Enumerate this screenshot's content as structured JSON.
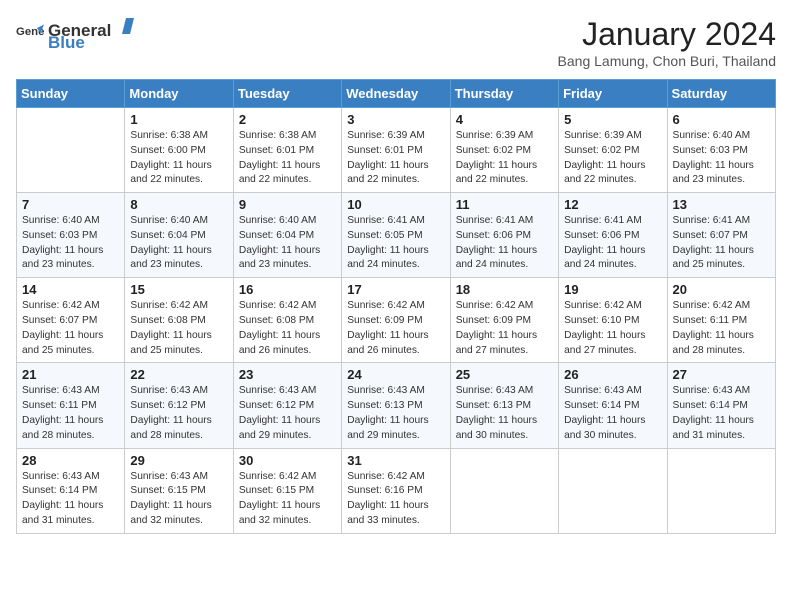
{
  "header": {
    "logo_general": "General",
    "logo_blue": "Blue",
    "month_year": "January 2024",
    "location": "Bang Lamung, Chon Buri, Thailand"
  },
  "days_of_week": [
    "Sunday",
    "Monday",
    "Tuesday",
    "Wednesday",
    "Thursday",
    "Friday",
    "Saturday"
  ],
  "weeks": [
    [
      {
        "day": "",
        "text": ""
      },
      {
        "day": "1",
        "text": "Sunrise: 6:38 AM\nSunset: 6:00 PM\nDaylight: 11 hours and 22 minutes."
      },
      {
        "day": "2",
        "text": "Sunrise: 6:38 AM\nSunset: 6:01 PM\nDaylight: 11 hours and 22 minutes."
      },
      {
        "day": "3",
        "text": "Sunrise: 6:39 AM\nSunset: 6:01 PM\nDaylight: 11 hours and 22 minutes."
      },
      {
        "day": "4",
        "text": "Sunrise: 6:39 AM\nSunset: 6:02 PM\nDaylight: 11 hours and 22 minutes."
      },
      {
        "day": "5",
        "text": "Sunrise: 6:39 AM\nSunset: 6:02 PM\nDaylight: 11 hours and 22 minutes."
      },
      {
        "day": "6",
        "text": "Sunrise: 6:40 AM\nSunset: 6:03 PM\nDaylight: 11 hours and 23 minutes."
      }
    ],
    [
      {
        "day": "7",
        "text": "Sunrise: 6:40 AM\nSunset: 6:03 PM\nDaylight: 11 hours and 23 minutes."
      },
      {
        "day": "8",
        "text": "Sunrise: 6:40 AM\nSunset: 6:04 PM\nDaylight: 11 hours and 23 minutes."
      },
      {
        "day": "9",
        "text": "Sunrise: 6:40 AM\nSunset: 6:04 PM\nDaylight: 11 hours and 23 minutes."
      },
      {
        "day": "10",
        "text": "Sunrise: 6:41 AM\nSunset: 6:05 PM\nDaylight: 11 hours and 24 minutes."
      },
      {
        "day": "11",
        "text": "Sunrise: 6:41 AM\nSunset: 6:06 PM\nDaylight: 11 hours and 24 minutes."
      },
      {
        "day": "12",
        "text": "Sunrise: 6:41 AM\nSunset: 6:06 PM\nDaylight: 11 hours and 24 minutes."
      },
      {
        "day": "13",
        "text": "Sunrise: 6:41 AM\nSunset: 6:07 PM\nDaylight: 11 hours and 25 minutes."
      }
    ],
    [
      {
        "day": "14",
        "text": "Sunrise: 6:42 AM\nSunset: 6:07 PM\nDaylight: 11 hours and 25 minutes."
      },
      {
        "day": "15",
        "text": "Sunrise: 6:42 AM\nSunset: 6:08 PM\nDaylight: 11 hours and 25 minutes."
      },
      {
        "day": "16",
        "text": "Sunrise: 6:42 AM\nSunset: 6:08 PM\nDaylight: 11 hours and 26 minutes."
      },
      {
        "day": "17",
        "text": "Sunrise: 6:42 AM\nSunset: 6:09 PM\nDaylight: 11 hours and 26 minutes."
      },
      {
        "day": "18",
        "text": "Sunrise: 6:42 AM\nSunset: 6:09 PM\nDaylight: 11 hours and 27 minutes."
      },
      {
        "day": "19",
        "text": "Sunrise: 6:42 AM\nSunset: 6:10 PM\nDaylight: 11 hours and 27 minutes."
      },
      {
        "day": "20",
        "text": "Sunrise: 6:42 AM\nSunset: 6:11 PM\nDaylight: 11 hours and 28 minutes."
      }
    ],
    [
      {
        "day": "21",
        "text": "Sunrise: 6:43 AM\nSunset: 6:11 PM\nDaylight: 11 hours and 28 minutes."
      },
      {
        "day": "22",
        "text": "Sunrise: 6:43 AM\nSunset: 6:12 PM\nDaylight: 11 hours and 28 minutes."
      },
      {
        "day": "23",
        "text": "Sunrise: 6:43 AM\nSunset: 6:12 PM\nDaylight: 11 hours and 29 minutes."
      },
      {
        "day": "24",
        "text": "Sunrise: 6:43 AM\nSunset: 6:13 PM\nDaylight: 11 hours and 29 minutes."
      },
      {
        "day": "25",
        "text": "Sunrise: 6:43 AM\nSunset: 6:13 PM\nDaylight: 11 hours and 30 minutes."
      },
      {
        "day": "26",
        "text": "Sunrise: 6:43 AM\nSunset: 6:14 PM\nDaylight: 11 hours and 30 minutes."
      },
      {
        "day": "27",
        "text": "Sunrise: 6:43 AM\nSunset: 6:14 PM\nDaylight: 11 hours and 31 minutes."
      }
    ],
    [
      {
        "day": "28",
        "text": "Sunrise: 6:43 AM\nSunset: 6:14 PM\nDaylight: 11 hours and 31 minutes."
      },
      {
        "day": "29",
        "text": "Sunrise: 6:43 AM\nSunset: 6:15 PM\nDaylight: 11 hours and 32 minutes."
      },
      {
        "day": "30",
        "text": "Sunrise: 6:42 AM\nSunset: 6:15 PM\nDaylight: 11 hours and 32 minutes."
      },
      {
        "day": "31",
        "text": "Sunrise: 6:42 AM\nSunset: 6:16 PM\nDaylight: 11 hours and 33 minutes."
      },
      {
        "day": "",
        "text": ""
      },
      {
        "day": "",
        "text": ""
      },
      {
        "day": "",
        "text": ""
      }
    ]
  ]
}
